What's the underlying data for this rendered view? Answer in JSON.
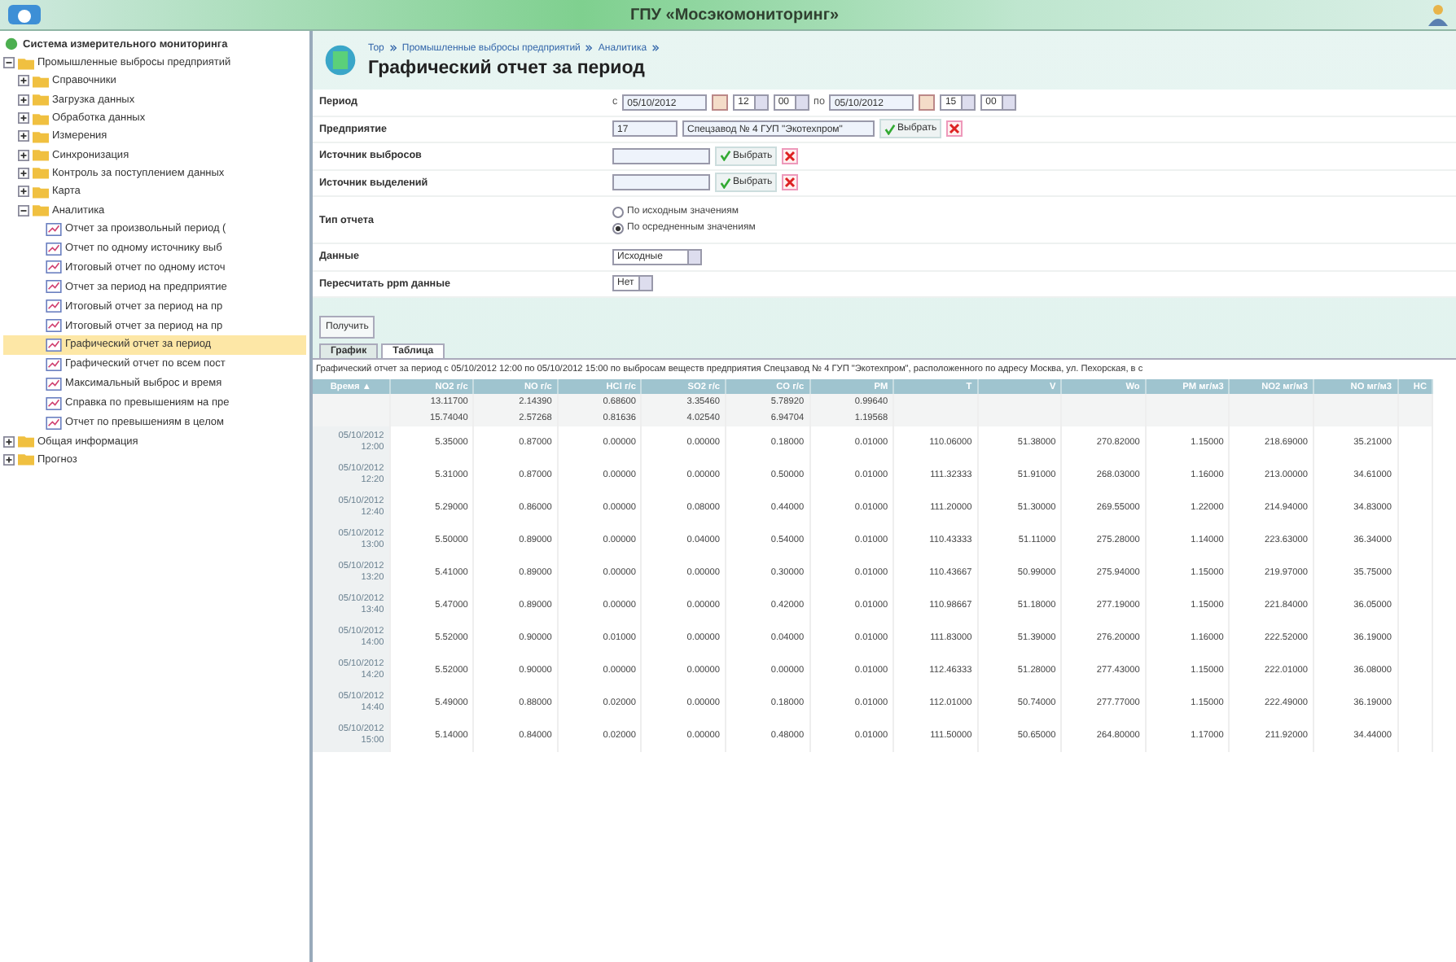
{
  "window": {
    "title": "ГПУ «Мосэкомониторинг»"
  },
  "sidebar": {
    "root": "Система измерительного мониторинга",
    "items": [
      {
        "label": "Промышленные выбросы предприятий",
        "kind": "folder",
        "expanded": true,
        "selected": false,
        "children": [
          {
            "label": "Справочники",
            "kind": "folder",
            "expanded": false,
            "selected": false
          },
          {
            "label": "Загрузка данных",
            "kind": "folder",
            "expanded": false,
            "selected": false
          },
          {
            "label": "Обработка данных",
            "kind": "folder",
            "expanded": false,
            "selected": false
          },
          {
            "label": "Измерения",
            "kind": "folder",
            "expanded": false,
            "selected": false
          },
          {
            "label": "Синхронизация",
            "kind": "folder",
            "expanded": false,
            "selected": false
          },
          {
            "label": "Контроль за поступлением данных",
            "kind": "folder",
            "expanded": false,
            "selected": false
          },
          {
            "label": "Карта",
            "kind": "folder",
            "expanded": false,
            "selected": false
          },
          {
            "label": "Аналитика",
            "kind": "folder",
            "expanded": true,
            "selected": false,
            "children": [
              {
                "label": "Отчет за произвольный период (",
                "kind": "report",
                "selected": false
              },
              {
                "label": "Отчет по одному источнику выб",
                "kind": "report",
                "selected": false
              },
              {
                "label": "Итоговый отчет по одному источ",
                "kind": "report",
                "selected": false
              },
              {
                "label": "Отчет за период на предприятие",
                "kind": "report",
                "selected": false
              },
              {
                "label": "Итоговый отчет за период на пр",
                "kind": "report",
                "selected": false
              },
              {
                "label": "Итоговый отчет за период на пр",
                "kind": "report",
                "selected": false
              },
              {
                "label": "Графический отчет за период",
                "kind": "report",
                "selected": true
              },
              {
                "label": "Графический отчет по всем пост",
                "kind": "report",
                "selected": false
              },
              {
                "label": "Максимальный выброс и время",
                "kind": "report",
                "selected": false
              },
              {
                "label": "Справка по превышениям на пре",
                "kind": "report",
                "selected": false
              },
              {
                "label": "Отчет по превышениям в целом",
                "kind": "report",
                "selected": false
              }
            ]
          }
        ]
      },
      {
        "label": "Общая информация",
        "kind": "folder",
        "expanded": false,
        "selected": false
      },
      {
        "label": "Прогноз",
        "kind": "folder",
        "expanded": false,
        "selected": false
      }
    ]
  },
  "breadcrumb": [
    "Тор",
    "Промышленные выбросы предприятий",
    "Аналитика"
  ],
  "page_title": "Графический отчет за период",
  "form": {
    "period": {
      "label": "Период",
      "from_prefix": "с",
      "from_date": "05/10/2012",
      "from_hour": "12",
      "from_min": "00",
      "to_prefix": "по",
      "to_date": "05/10/2012",
      "to_hour": "15",
      "to_min": "00"
    },
    "enterprise": {
      "label": "Предприятие",
      "code": "17",
      "name": "Спецзавод № 4 ГУП \"Экотехпром\"",
      "choose": "Выбрать"
    },
    "emission_source": {
      "label": "Источник выбросов",
      "choose": "Выбрать"
    },
    "release_source": {
      "label": "Источник выделений",
      "choose": "Выбрать"
    },
    "report_type": {
      "label": "Тип отчета",
      "options": [
        {
          "label": "По исходным значениям",
          "selected": false
        },
        {
          "label": "По осредненным значениям",
          "selected": true
        }
      ]
    },
    "data": {
      "label": "Данные",
      "value": "Исходные"
    },
    "ppm": {
      "label": "Пересчитать ppm данные",
      "value": "Нет"
    },
    "submit": "Получить"
  },
  "tabs": [
    {
      "label": "График",
      "selected": false
    },
    {
      "label": "Таблица",
      "selected": true
    }
  ],
  "caption": "Графический отчет за период с 05/10/2012 12:00 по 05/10/2012 15:00 по выбросам веществ предприятия Спецзавод № 4 ГУП \"Экотехпром\", расположенного по адресу Москва, ул. Пехорская, в с",
  "table": {
    "columns": [
      "Время ▲",
      "NO2 г/с",
      "NO г/с",
      "HCl г/с",
      "SO2 г/с",
      "CO г/с",
      "PM",
      "T",
      "V",
      "Wo",
      "PM мг/м3",
      "NO2 мг/м3",
      "NO мг/м3",
      "НС"
    ],
    "rows": [
      {
        "kind": "summary",
        "cells": [
          "",
          "13.11700",
          "2.14390",
          "0.68600",
          "3.35460",
          "5.78920",
          "0.99640"
        ]
      },
      {
        "kind": "summary",
        "cells": [
          "",
          "15.74040",
          "2.57268",
          "0.81636",
          "4.02540",
          "6.94704",
          "1.19568"
        ]
      },
      {
        "kind": "data",
        "cells": [
          "05/10/2012 12:00",
          "5.35000",
          "0.87000",
          "0.00000",
          "0.00000",
          "0.18000",
          "0.01000",
          "110.06000",
          "51.38000",
          "270.82000",
          "1.15000",
          "218.69000",
          "35.21000"
        ]
      },
      {
        "kind": "data",
        "cells": [
          "05/10/2012 12:20",
          "5.31000",
          "0.87000",
          "0.00000",
          "0.00000",
          "0.50000",
          "0.01000",
          "111.32333",
          "51.91000",
          "268.03000",
          "1.16000",
          "213.00000",
          "34.61000"
        ]
      },
      {
        "kind": "data",
        "cells": [
          "05/10/2012 12:40",
          "5.29000",
          "0.86000",
          "0.00000",
          "0.08000",
          "0.44000",
          "0.01000",
          "111.20000",
          "51.30000",
          "269.55000",
          "1.22000",
          "214.94000",
          "34.83000"
        ]
      },
      {
        "kind": "data",
        "cells": [
          "05/10/2012 13:00",
          "5.50000",
          "0.89000",
          "0.00000",
          "0.04000",
          "0.54000",
          "0.01000",
          "110.43333",
          "51.11000",
          "275.28000",
          "1.14000",
          "223.63000",
          "36.34000"
        ]
      },
      {
        "kind": "data",
        "cells": [
          "05/10/2012 13:20",
          "5.41000",
          "0.89000",
          "0.00000",
          "0.00000",
          "0.30000",
          "0.01000",
          "110.43667",
          "50.99000",
          "275.94000",
          "1.15000",
          "219.97000",
          "35.75000"
        ]
      },
      {
        "kind": "data",
        "cells": [
          "05/10/2012 13:40",
          "5.47000",
          "0.89000",
          "0.00000",
          "0.00000",
          "0.42000",
          "0.01000",
          "110.98667",
          "51.18000",
          "277.19000",
          "1.15000",
          "221.84000",
          "36.05000"
        ]
      },
      {
        "kind": "data",
        "cells": [
          "05/10/2012 14:00",
          "5.52000",
          "0.90000",
          "0.01000",
          "0.00000",
          "0.04000",
          "0.01000",
          "111.83000",
          "51.39000",
          "276.20000",
          "1.16000",
          "222.52000",
          "36.19000"
        ]
      },
      {
        "kind": "data",
        "cells": [
          "05/10/2012 14:20",
          "5.52000",
          "0.90000",
          "0.00000",
          "0.00000",
          "0.00000",
          "0.01000",
          "112.46333",
          "51.28000",
          "277.43000",
          "1.15000",
          "222.01000",
          "36.08000"
        ]
      },
      {
        "kind": "data",
        "cells": [
          "05/10/2012 14:40",
          "5.49000",
          "0.88000",
          "0.02000",
          "0.00000",
          "0.18000",
          "0.01000",
          "112.01000",
          "50.74000",
          "277.77000",
          "1.15000",
          "222.49000",
          "36.19000"
        ]
      },
      {
        "kind": "data",
        "cells": [
          "05/10/2012 15:00",
          "5.14000",
          "0.84000",
          "0.02000",
          "0.00000",
          "0.48000",
          "0.01000",
          "111.50000",
          "50.65000",
          "264.80000",
          "1.17000",
          "211.92000",
          "34.44000"
        ]
      }
    ]
  }
}
